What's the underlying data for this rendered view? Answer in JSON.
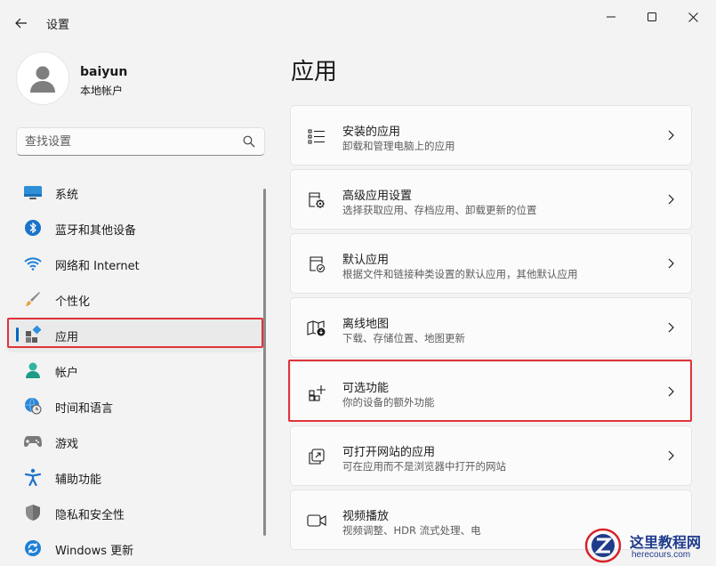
{
  "window": {
    "title": "设置",
    "icons": {
      "back": "back-arrow-icon",
      "minimize": "minimize-icon",
      "maximize": "maximize-icon",
      "close": "close-icon"
    }
  },
  "user": {
    "name": "baiyun",
    "account_type": "本地帐户"
  },
  "search": {
    "placeholder": "查找设置",
    "value": ""
  },
  "sidebar": {
    "items": [
      {
        "label": "系统",
        "icon": "system-icon",
        "selected": false
      },
      {
        "label": "蓝牙和其他设备",
        "icon": "bluetooth-icon",
        "selected": false
      },
      {
        "label": "网络和 Internet",
        "icon": "wifi-icon",
        "selected": false
      },
      {
        "label": "个性化",
        "icon": "brush-icon",
        "selected": false
      },
      {
        "label": "应用",
        "icon": "apps-icon",
        "selected": true
      },
      {
        "label": "帐户",
        "icon": "account-icon",
        "selected": false
      },
      {
        "label": "时间和语言",
        "icon": "globe-clock-icon",
        "selected": false
      },
      {
        "label": "游戏",
        "icon": "gamepad-icon",
        "selected": false
      },
      {
        "label": "辅助功能",
        "icon": "accessibility-icon",
        "selected": false
      },
      {
        "label": "隐私和安全性",
        "icon": "shield-icon",
        "selected": false
      },
      {
        "label": "Windows 更新",
        "icon": "update-icon",
        "selected": false
      }
    ]
  },
  "main": {
    "title": "应用",
    "cards": [
      {
        "title": "安装的应用",
        "subtitle": "卸载和管理电脑上的应用",
        "icon": "installed-apps-icon"
      },
      {
        "title": "高级应用设置",
        "subtitle": "选择获取应用、存档应用、卸载更新的位置",
        "icon": "advanced-app-settings-icon"
      },
      {
        "title": "默认应用",
        "subtitle": "根据文件和链接种类设置的默认应用，其他默认应用",
        "icon": "default-apps-icon"
      },
      {
        "title": "离线地图",
        "subtitle": "下载、存储位置、地图更新",
        "icon": "offline-maps-icon"
      },
      {
        "title": "可选功能",
        "subtitle": "你的设备的额外功能",
        "icon": "optional-features-icon"
      },
      {
        "title": "可打开网站的应用",
        "subtitle": "可在应用而不是浏览器中打开的网站",
        "icon": "apps-for-websites-icon"
      },
      {
        "title": "视频播放",
        "subtitle": "视频调整、HDR 流式处理、电",
        "icon": "video-playback-icon"
      }
    ]
  },
  "watermark": {
    "name": "这里教程网",
    "url": "herecours.com"
  },
  "colors": {
    "accent": "#0067c0",
    "highlight": "#e0333a",
    "background": "#f3f3f3",
    "card": "#fbfbfb"
  }
}
